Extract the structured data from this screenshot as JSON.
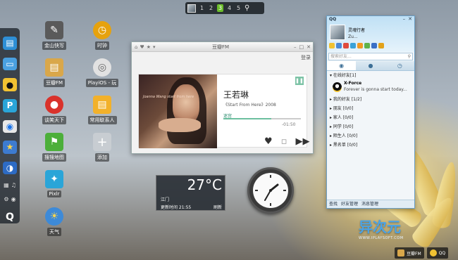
{
  "workspaces": {
    "items": [
      "1",
      "2",
      "3",
      "4",
      "5"
    ],
    "active": "3"
  },
  "desktop_icons": [
    {
      "label": "金山快写",
      "icon": "pencil-notebook-icon",
      "color": "#5a5a5a"
    },
    {
      "label": "时钟",
      "icon": "clock-icon",
      "color": "#e6a20e"
    },
    {
      "label": "豆瓣FM",
      "icon": "radio-icon",
      "color": "#d9a74a"
    },
    {
      "label": "PlayiOS - 玩",
      "icon": "disc-icon",
      "color": "#d8d8d8"
    },
    {
      "label": "谈笑天下",
      "icon": "chat-icon",
      "color": "#d9322b"
    },
    {
      "label": "常用联系人",
      "icon": "contacts-book-icon",
      "color": "#f2b12b"
    },
    {
      "label": "搜搜地图",
      "icon": "map-flag-icon",
      "color": "#4caf3a"
    },
    {
      "label": "添加",
      "icon": "add-icon",
      "color": "#c8cdd2"
    },
    {
      "label": "Pixlr",
      "icon": "pixlr-icon",
      "color": "#2aa5d8"
    },
    {
      "label": "天气",
      "icon": "weather-sun-icon",
      "color": "#3d8ad8"
    }
  ],
  "dock_icons": [
    "bag-icon",
    "drive-icon",
    "qq-penguin-icon",
    "qzone-icon",
    "chrome-icon",
    "star-icon",
    "globe-icon"
  ],
  "fm": {
    "title": "豆瓣FM",
    "login": "登录",
    "artist": "王若琳",
    "album": "《Start From Here》2008",
    "song": "迷宫",
    "progress": 0.62,
    "time": "-01:50",
    "cover_text": "Joanna Wang start from here"
  },
  "weather": {
    "temperature": "27°C",
    "city": "江门",
    "updated": "更新时间 21:55",
    "refresh": "刷新"
  },
  "qq": {
    "brand": "QQ",
    "nickname": "灵魂行者",
    "signature": "Zu...",
    "search_placeholder": "搜索好友...",
    "groups": [
      {
        "label": "在线好友[1]",
        "expanded": true
      },
      {
        "label": "我的好友 [1/2]",
        "expanded": false
      },
      {
        "label": "朋友 [0/0]",
        "expanded": false
      },
      {
        "label": "家人 [0/0]",
        "expanded": false
      },
      {
        "label": "同学 [0/0]",
        "expanded": false
      },
      {
        "label": "陌生人 [0/0]",
        "expanded": false
      },
      {
        "label": "黑名单 [0/0]",
        "expanded": false
      }
    ],
    "friend": {
      "name": "X-Force",
      "status": "Forever is gonna start today..."
    },
    "footer": [
      "查找",
      "好友管理",
      "消息管理"
    ]
  },
  "taskbar": [
    {
      "label": "豆瓣FM",
      "icon": "radio-icon",
      "color": "#d9a74a"
    },
    {
      "label": "QQ",
      "icon": "qq-penguin-icon",
      "color": "#f1c232"
    }
  ],
  "watermark": {
    "title": "异次元",
    "url": "WWW.IPLAYSOFT.COM"
  }
}
